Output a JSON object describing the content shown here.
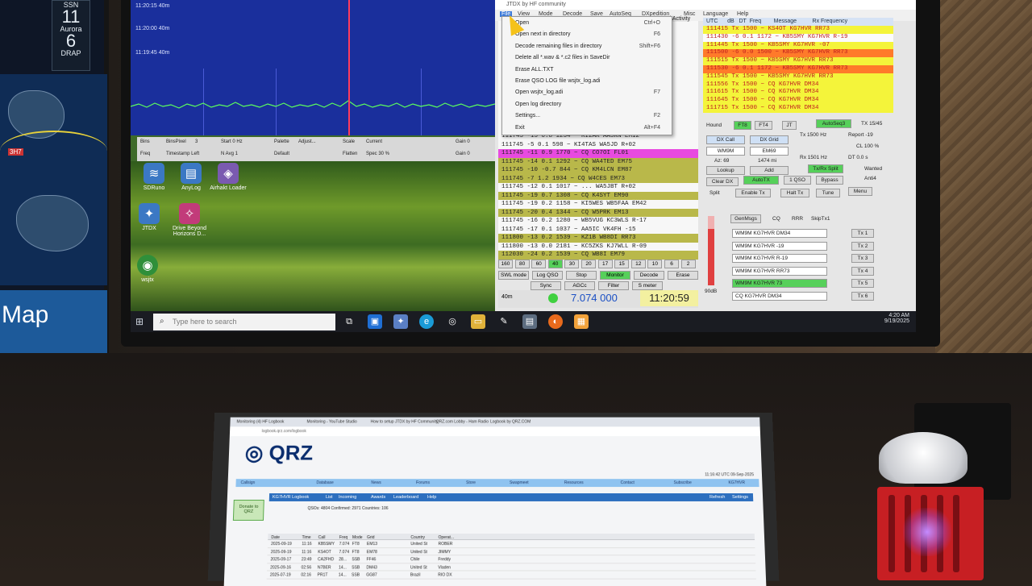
{
  "left_monitor": {
    "ssn_label": "SSN",
    "ssn_value": "11",
    "aurora_label": "Aurora",
    "aurora_value": "6",
    "drap_label": "DRAP",
    "map_label": "Map",
    "map_marker": "3H7"
  },
  "waterfall": {
    "rows": [
      {
        "time": "11:20:15",
        "band": "40m"
      },
      {
        "time": "11:20:00",
        "band": "40m"
      },
      {
        "time": "11:19:45",
        "band": "40m"
      }
    ],
    "controls": [
      "Bins",
      "BinsPixel",
      "3",
      "Start 0 Hz",
      "Palette",
      "Adjust...",
      "Scale",
      "Current",
      "Gain 0",
      "Freq",
      "Timestamp Left",
      "N Avg 1",
      "Default",
      "Flatten",
      "Spec 30 %",
      "Gain 0"
    ]
  },
  "desktop_icons": [
    {
      "label": "SDRuno",
      "icon": "radio-icon"
    },
    {
      "label": "AnyLog",
      "icon": "log-icon"
    },
    {
      "label": "Airhakt Loader",
      "icon": "app-icon"
    },
    {
      "label": "JTDX",
      "icon": "compass-icon"
    },
    {
      "label": "Drive Beyond Horizons D...",
      "icon": "game-icon"
    },
    {
      "label": "wsjtx",
      "icon": "globe-icon"
    }
  ],
  "taskbar": {
    "search_placeholder": "Type here to search",
    "time": "4:20 AM",
    "date": "9/19/2025"
  },
  "jtdx": {
    "title": "JTDX by HF community",
    "menubar": [
      "File",
      "View",
      "Mode",
      "Decode",
      "Save",
      "AutoSeq",
      "DXpedition",
      "Misc",
      "Language",
      "Help"
    ],
    "file_menu": [
      {
        "label": "Open",
        "shortcut": "Ctrl+O"
      },
      {
        "label": "Open next in directory",
        "shortcut": "F6"
      },
      {
        "label": "Decode remaining files in directory",
        "shortcut": "Shift+F6"
      },
      {
        "label": "Delete all *.wav & *.c2 files in SaveDir",
        "shortcut": ""
      },
      {
        "label": "Erase ALL.TXT",
        "shortcut": ""
      },
      {
        "label": "Erase QSO LOG file wsjtx_log.adi",
        "shortcut": ""
      },
      {
        "label": "Open wsjtx_log.adi",
        "shortcut": "F7"
      },
      {
        "label": "Open log directory",
        "shortcut": ""
      },
      {
        "label": "Settings...",
        "shortcut": "F2"
      },
      {
        "label": "Exit",
        "shortcut": "Alt+F4"
      }
    ],
    "band_activity_title": "Band Activity",
    "band_activity": [
      {
        "t": "111745  -15  0.8  1234 ~ KI2AK AA5RN EM12",
        "hl": ""
      },
      {
        "t": "111745   -5  0.1   598 ~ KI4TAS WA5JD R+02",
        "hl": ""
      },
      {
        "t": "111745  -11  0.9  1770 ~ CQ CO7OI FL01",
        "hl": "magenta"
      },
      {
        "t": "111745  -14  0.1  1292 ~ CQ WA4TED EM75",
        "hl": "olive"
      },
      {
        "t": "111745  -10 -0.7   844 ~ CQ KM4LCN EM87",
        "hl": "olive"
      },
      {
        "t": "111745   -7  1.2  1934 ~ CQ W4CES EM73",
        "hl": "olive"
      },
      {
        "t": "111745  -12  0.1  1017 ~ ...  WA5JBT R+02",
        "hl": ""
      },
      {
        "t": "111745  -19  0.7  1308 ~ CQ K4SYT EM90",
        "hl": "olive"
      },
      {
        "t": "111745  -19  0.2  1158 ~ KI5WES WB5FAA EM42",
        "hl": ""
      },
      {
        "t": "111745  -20  0.4  1344 ~ CQ W5PRK EM13",
        "hl": "olive"
      },
      {
        "t": "111745  -16  0.2  1280 ~ WB5VUG KC3WLS R-17",
        "hl": ""
      },
      {
        "t": "111745  -17  0.1  1037 ~ AA5IC VK4FH -15",
        "hl": ""
      },
      {
        "t": "111800  -13  0.2  1539 ~ KZ1B WB8DI RR73",
        "hl": "olive"
      },
      {
        "t": "111800  -13  0.0  2181 ~ KC5ZKS KJ7WLL R-09",
        "hl": ""
      },
      {
        "t": "112030  -24  0.2  1539 ~ CQ WB8I EM79",
        "hl": "olive"
      }
    ],
    "rx_header": [
      "UTC",
      "dB",
      "DT",
      "Freq",
      "Message",
      "Rx Frequency"
    ],
    "rx_frequency": [
      {
        "t": "111415  Tx        1500 ~ KS4OT KG7HVR RR73",
        "hl": "yellow"
      },
      {
        "t": "111430   -6  0.1  1172 ~ KB5SMY KG7HVR R-19",
        "hl": ""
      },
      {
        "t": "111445  Tx        1500 ~ KB5SMY KG7HVR -07",
        "hl": "yellow"
      },
      {
        "t": "111500   -6  0.0  1500 ~ KB5SMY KG7HVR RR73",
        "hl": "orange"
      },
      {
        "t": "111515  Tx        1500 ~ KB5SMY KG7HVR RR73",
        "hl": "yellow"
      },
      {
        "t": "111530   -6  0.1  1172 ~ KB5SMY KG7HVR RR73",
        "hl": "orange"
      },
      {
        "t": "111545  Tx        1500 ~ KB5SMY KG7HVR RR73",
        "hl": "yellow"
      },
      {
        "t": "111556  Tx        1500 ~ CQ KG7HVR DM34",
        "hl": "yellow"
      },
      {
        "t": "111615  Tx        1500 ~ CQ KG7HVR DM34",
        "hl": "yellow"
      },
      {
        "t": "111645  Tx        1500 ~ CQ KG7HVR DM34",
        "hl": "yellow"
      },
      {
        "t": "111715  Tx        1500 ~ CQ KG7HVR DM34",
        "hl": "yellow"
      }
    ],
    "controls": {
      "hound": "Hound",
      "ft8": "FT8",
      "ft4": "FT4",
      "jt": "JT",
      "autoseq": "AutoSeq3",
      "tx_period": "TX 15/45",
      "dx_call_label": "DX Call",
      "dx_grid_label": "DX Grid",
      "dx_call": "WM9M",
      "dx_grid": "EM69",
      "az": "Az: 69",
      "dist": "1474 mi",
      "lookup": "Lookup",
      "add": "Add",
      "clear_dx": "Clear DX",
      "autotx": "AutoTX",
      "qso1": "1 QSO",
      "bypass": "Bypass",
      "split": "Split",
      "enable_tx": "Enable Tx",
      "halt_tx": "Halt Tx",
      "tune": "Tune",
      "menu": "Menu",
      "tx_hz": "Tx 1500 Hz",
      "report": "Report -19",
      "rx_hz": "Rx 1501 Hz",
      "dt": "DT 0.0 s",
      "cl": "CL 100 %",
      "txrx_split": "Tx/Rx Split",
      "wanted": "Wanted",
      "anti4": "Anti4",
      "genmsgs": "GenMsgs",
      "cq": "CQ",
      "rrr": "RRR",
      "skiptx1": "SkipTx1",
      "tx_messages": [
        "WM9M KG7HVR DM34",
        "WM9M KG7HVR -19",
        "WM9M KG7HVR R-19",
        "WM9M KG7HVR RR73",
        "WM9M KG7HVR 73",
        "CQ KG7HVR DM34"
      ],
      "tx_buttons": [
        "Tx 1",
        "Tx 2",
        "Tx 3",
        "Tx 4",
        "Tx 5",
        "Tx 6"
      ],
      "db_label": "90dB"
    },
    "bands": [
      "160",
      "80",
      "60",
      "40",
      "30",
      "20",
      "17",
      "15",
      "12",
      "10",
      "6",
      "2"
    ],
    "bottom_buttons": [
      "SWL mode",
      "Log QSO",
      "Stop",
      "Monitor",
      "Decode",
      "Erase",
      "Sync",
      "AGCc",
      "Filter",
      "S meter"
    ],
    "band": "40m",
    "frequency": "7.074 000",
    "utc_clock": "11:20:59"
  },
  "laptop": {
    "tabs": [
      "Monitoring (4) HF Logbook",
      "Monitoring - YouTube Studio",
      "How to setup JTDX by HF Community",
      "QRZ.com Lobby - Ham Radio",
      "Logbook by QRZ.COM"
    ],
    "url": "logbook.qrz.com/logbook",
    "logo": "QRZ",
    "utc": "11:16:42 UTC 09-Sep-2025",
    "nav": [
      "Callsign",
      "Database",
      "News",
      "Forums",
      "Store",
      "Swapmeet",
      "Resources",
      "Contact",
      "Subscribe",
      "KG7HVR"
    ],
    "logbook_bar": [
      "KG7HVR Logbook",
      "List",
      "Incoming",
      "Awards",
      "Leaderboard",
      "Help",
      "Refresh",
      "Settings"
    ],
    "donate": "Donate to QRZ",
    "stats": "QSOs: 4804  Confirmed: 2971  Countries: 106",
    "columns": [
      "Date",
      "Time",
      "Call",
      "Freq",
      "Mode",
      "Grid",
      "Country",
      "Operat..."
    ],
    "rows": [
      {
        "date": "2025-09-19",
        "time": "11:16",
        "call": "KB5SMY",
        "freq": "7.074",
        "mode": "FT8",
        "grid": "EM13",
        "country": "United St",
        "op": "ROBER"
      },
      {
        "date": "2025-09-19",
        "time": "11:16",
        "call": "KS4OT",
        "freq": "7.074",
        "mode": "FT8",
        "grid": "EM78",
        "country": "United St",
        "op": "JIMMY"
      },
      {
        "date": "2025-09-17",
        "time": "23:49",
        "call": "CA2FHD",
        "freq": "28...",
        "mode": "SSB",
        "grid": "FF46",
        "country": "Chile",
        "op": "Freddy"
      },
      {
        "date": "2025-09-16",
        "time": "02:56",
        "call": "N7BER",
        "freq": "14...",
        "mode": "SSB",
        "grid": "DM43",
        "country": "United St",
        "op": "Vladen"
      },
      {
        "date": "2025-07-19",
        "time": "02:16",
        "call": "PR1T",
        "freq": "14...",
        "mode": "SSB",
        "grid": "GG87",
        "country": "Brazil",
        "op": "RIO DX"
      }
    ]
  },
  "colors": {
    "jtdx_yellow": "#f4f43a",
    "jtdx_magenta": "#e84ae0",
    "jtdx_olive": "#b9b84a",
    "jtdx_orange": "#ff7a2a",
    "qrz_blue": "#2d6fbf",
    "green_button": "#56d05a"
  }
}
